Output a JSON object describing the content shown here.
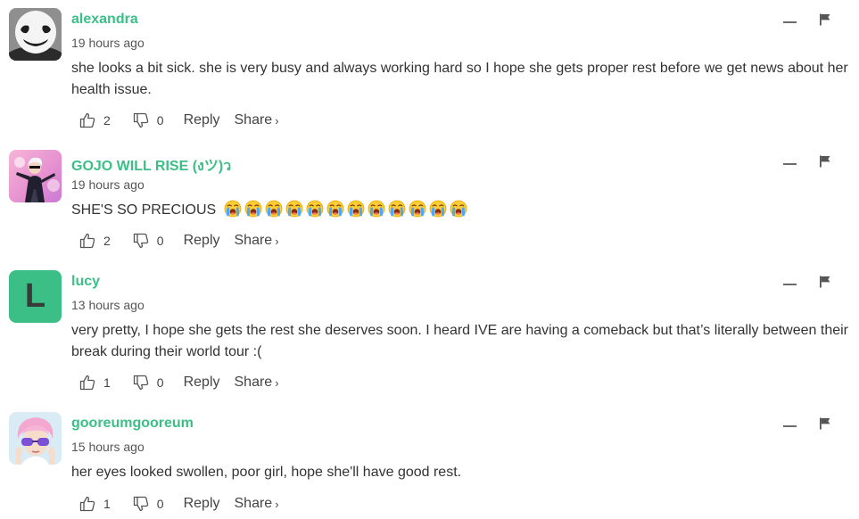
{
  "comments": [
    {
      "username": "alexandra",
      "timestamp": "19 hours ago",
      "body": "she looks a bit sick. she is very busy and always working hard so I hope she gets proper rest before we get news about her health issue.",
      "likes": "2",
      "dislikes": "0",
      "reply_label": "Reply",
      "share_label": "Share",
      "avatar": "marshmello-mask-icon"
    },
    {
      "username": "GOJO WILL RISE (งツ)ว",
      "timestamp": "19 hours ago",
      "body": "SHE'S SO PRECIOUS",
      "emoji_count": 12,
      "emoji": "loudly-crying-face-icon",
      "likes": "2",
      "dislikes": "0",
      "reply_label": "Reply",
      "share_label": "Share",
      "avatar": "anime-character-photo"
    },
    {
      "username": "lucy",
      "timestamp": "13 hours ago",
      "body": "very pretty, I hope she gets the rest she deserves soon. I heard IVE are having a comeback but that’s literally between their break during their world tour :(",
      "likes": "1",
      "dislikes": "0",
      "reply_label": "Reply",
      "share_label": "Share",
      "avatar_letter": "L",
      "avatar_color": "#3cbf87"
    },
    {
      "username": "gooreumgooreum",
      "timestamp": "15 hours ago",
      "body": "her eyes looked swollen, poor girl, hope she'll have good rest.",
      "likes": "1",
      "dislikes": "0",
      "reply_label": "Reply",
      "share_label": "Share",
      "avatar": "pink-hair-person-photo"
    }
  ],
  "share_chevron": "›",
  "colors": {
    "username": "#3cbf87",
    "text": "#333333",
    "meta": "#555555"
  }
}
